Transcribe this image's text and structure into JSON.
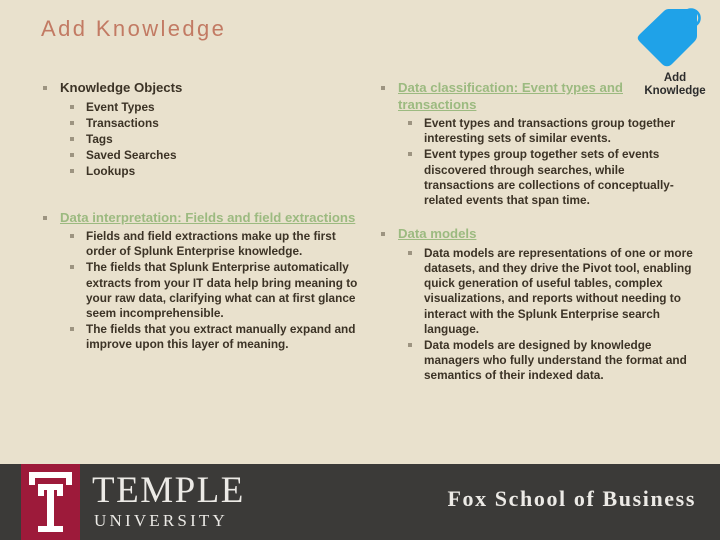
{
  "slide": {
    "title": "Add Knowledge",
    "title_color": "#c27a63",
    "background_color": "#e9e1cd",
    "link_color": "#9cba80",
    "body_color": "#3c3326",
    "bullet_color": "#9d9481"
  },
  "tag_badge": {
    "icon": "tag-icon",
    "icon_color": "#1fa2e8",
    "label": "Add\nKnowledge"
  },
  "left_column": {
    "groups": [
      {
        "heading": "Knowledge Objects",
        "is_link": false,
        "items": [
          "Event Types",
          "Transactions",
          "Tags",
          "Saved Searches",
          "Lookups"
        ]
      },
      {
        "heading": "Data interpretation: Fields and field extractions",
        "is_link": true,
        "items": [
          "Fields and field extractions make up the first order of Splunk Enterprise knowledge.",
          "The fields that Splunk Enterprise automatically extracts from your IT data help bring meaning to your raw data, clarifying what can at first glance seem incomprehensible.",
          "The fields that you extract manually expand and improve upon this layer of meaning."
        ]
      }
    ]
  },
  "right_column": {
    "groups": [
      {
        "heading": "Data classification: Event types and transactions",
        "is_link": true,
        "items": [
          "Event types and transactions group together interesting sets of similar events.",
          "Event types group together sets of events discovered through searches, while transactions are collections of conceptually-related events that span time."
        ]
      },
      {
        "heading": "Data models",
        "is_link": true,
        "items": [
          "Data models are representations of one or more datasets, and they drive the Pivot tool, enabling quick generation of useful tables, complex visualizations, and reports without needing to interact with the Splunk Enterprise search language.",
          "Data models are designed by knowledge managers who fully understand the format and semantics of their indexed data."
        ]
      }
    ]
  },
  "footer": {
    "background_color": "#3b3a38",
    "logo_color": "#9d1a3a",
    "university_name_line1": "TEMPLE",
    "university_name_line2": "UNIVERSITY",
    "school_name": "Fox School of Business"
  }
}
